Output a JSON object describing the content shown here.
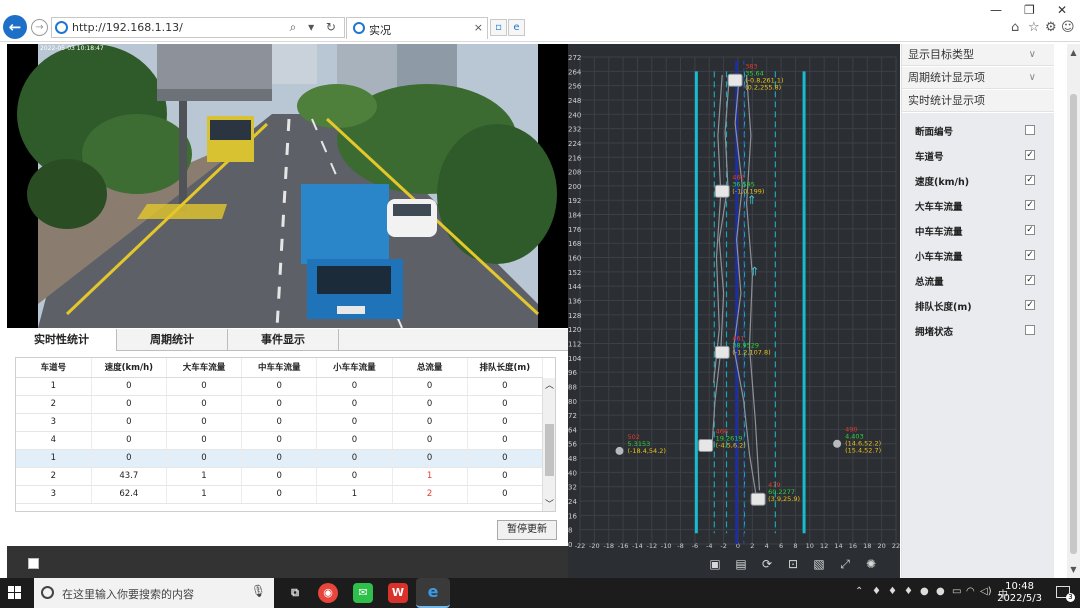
{
  "browser": {
    "url": "http://192.168.1.13/",
    "tab_title": "实况",
    "search_glyph": "⌕ ▾ ↻",
    "close": "×"
  },
  "video": {
    "osd_text": "2022-05-03 10:18:47"
  },
  "panel_tabs": [
    {
      "label": "实时性统计",
      "active": true
    },
    {
      "label": "周期统计",
      "active": false
    },
    {
      "label": "事件显示",
      "active": false
    }
  ],
  "table": {
    "headers": [
      "车道号",
      "速度(km/h)",
      "大车车流量",
      "中车车流量",
      "小车车流量",
      "总流量",
      "排队长度(m)"
    ],
    "rows": [
      [
        "1",
        "0",
        "0",
        "0",
        "0",
        "0",
        "0"
      ],
      [
        "2",
        "0",
        "0",
        "0",
        "0",
        "0",
        "0"
      ],
      [
        "3",
        "0",
        "0",
        "0",
        "0",
        "0",
        "0"
      ],
      [
        "4",
        "0",
        "0",
        "0",
        "0",
        "0",
        "0"
      ],
      [
        "1",
        "0",
        "0",
        "0",
        "0",
        "0",
        "0"
      ],
      [
        "2",
        "43.7",
        "1",
        "0",
        "0",
        "1",
        "0"
      ],
      [
        "3",
        "62.4",
        "1",
        "0",
        "1",
        "2",
        "0"
      ]
    ],
    "selected_row_index": 4,
    "red_cells": [
      [
        5,
        5
      ],
      [
        6,
        5
      ]
    ]
  },
  "pause_button": "暂停更新",
  "radar": {
    "y_ticks": [
      "272",
      "264",
      "256",
      "248",
      "240",
      "232",
      "224",
      "216",
      "208",
      "200",
      "192",
      "184",
      "176",
      "168",
      "160",
      "152",
      "144",
      "136",
      "128",
      "120",
      "112",
      "104",
      "96",
      "88",
      "80",
      "72",
      "64",
      "56",
      "48",
      "40",
      "32",
      "24",
      "16",
      "8",
      "0"
    ],
    "x_ticks": [
      "-22",
      "-20",
      "-18",
      "-16",
      "-14",
      "-12",
      "-10",
      "-8",
      "-6",
      "-4",
      "-2",
      "0",
      "2",
      "4",
      "6",
      "8",
      "10",
      "12",
      "14",
      "16",
      "18",
      "20",
      "22"
    ],
    "targets": [
      {
        "id": "383",
        "speed": "35.64",
        "pos": "(-0.8,261.1)",
        "pos2": "(0.2,255.8)",
        "x": -0.4,
        "y": 259
      },
      {
        "id": "462",
        "speed": "36.595",
        "pos": "(-1,0.199)",
        "x": -2.2,
        "y": 197
      },
      {
        "id": "461",
        "speed": "38.9529",
        "pos": "(-1.2,107.8)",
        "x": -2.2,
        "y": 107
      },
      {
        "id": "466",
        "speed": "19.2619",
        "pos": "(-4.5,6.2)",
        "x": -4.5,
        "y": 55
      },
      {
        "id": "479",
        "speed": "60.2277",
        "pos": "(3.9,25.9)",
        "x": 2.8,
        "y": 25
      },
      {
        "id": "502",
        "speed": "5.3153",
        "pos": "(-18.4,54.2)",
        "x": -16.5,
        "y": 52
      },
      {
        "id": "490",
        "speed": "4.403",
        "pos": "(14.6,52.2)",
        "pos2": "(15.4,52.7)",
        "x": 13.8,
        "y": 56
      }
    ],
    "tool_icons": [
      "image-icon",
      "film-icon",
      "refresh-icon",
      "focus-icon",
      "picture-icon",
      "fullscreen-icon",
      "settings-icon"
    ]
  },
  "settings": {
    "sections": [
      "显示目标类型",
      "周期统计显示项",
      "实时统计显示项"
    ],
    "options": [
      {
        "label": "断面编号",
        "checked": false
      },
      {
        "label": "车道号",
        "checked": true
      },
      {
        "label": "速度(km/h)",
        "checked": true
      },
      {
        "label": "大车车流量",
        "checked": true
      },
      {
        "label": "中车车流量",
        "checked": true
      },
      {
        "label": "小车车流量",
        "checked": true
      },
      {
        "label": "总流量",
        "checked": true
      },
      {
        "label": "排队长度(m)",
        "checked": true
      },
      {
        "label": "拥堵状态",
        "checked": false
      }
    ]
  },
  "taskbar": {
    "search_placeholder": "在这里输入你要搜索的内容",
    "time": "10:48",
    "date": "2022/5/3",
    "ime": "中",
    "notification_count": "3"
  },
  "colors": {
    "radar_bg": "#2b2e33",
    "lane_boundary": "#17bcd0",
    "lane_center": "#1d2f9e",
    "target_id": "#e23b2c",
    "target_speed": "#2fd13a",
    "target_pos": "#e8c21a"
  }
}
